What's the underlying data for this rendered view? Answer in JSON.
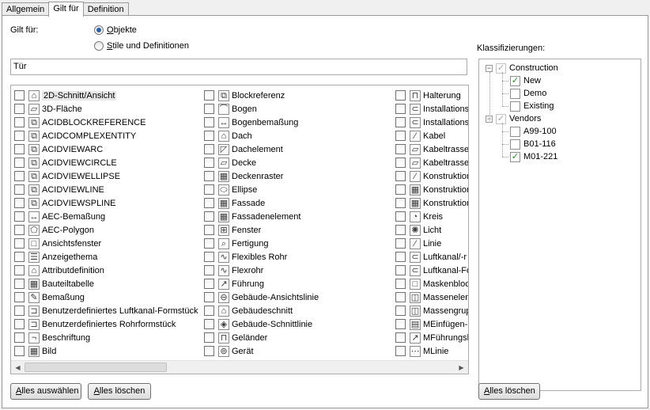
{
  "tabs": [
    "Allgemein",
    "Gilt für",
    "Definition"
  ],
  "gilt_fuer_label": "Gilt für:",
  "radios": [
    {
      "prefix": "",
      "underline": "O",
      "rest": "bjekte",
      "checked": true
    },
    {
      "prefix": "",
      "underline": "S",
      "rest": "tile und Definitionen",
      "checked": false
    }
  ],
  "filter_value": "Tür",
  "columns": [
    [
      {
        "label": "2D-Schnitt/Ansicht",
        "icon": "⌂",
        "selected": true
      },
      {
        "label": "3D-Fläche",
        "icon": "▱"
      },
      {
        "label": "ACIDBLOCKREFERENCE",
        "icon": "⧉"
      },
      {
        "label": "ACIDCOMPLEXENTITY",
        "icon": "⧉"
      },
      {
        "label": "ACIDVIEWARC",
        "icon": "⧉"
      },
      {
        "label": "ACIDVIEWCIRCLE",
        "icon": "⧉"
      },
      {
        "label": "ACIDVIEWELLIPSE",
        "icon": "⧉"
      },
      {
        "label": "ACIDVIEWLINE",
        "icon": "⧉"
      },
      {
        "label": "ACIDVIEWSPLINE",
        "icon": "⧉"
      },
      {
        "label": "AEC-Bemaßung",
        "icon": "↔"
      },
      {
        "label": "AEC-Polygon",
        "icon": "⬠"
      },
      {
        "label": "Ansichtsfenster",
        "icon": "□"
      },
      {
        "label": "Anzeigethema",
        "icon": "☰"
      },
      {
        "label": "Attributdefinition",
        "icon": "⌂"
      },
      {
        "label": "Bauteiltabelle",
        "icon": "▦"
      },
      {
        "label": "Bemaßung",
        "icon": "✎"
      },
      {
        "label": "Benutzerdefiniertes Luftkanal-Formstück",
        "icon": "⊐"
      },
      {
        "label": "Benutzerdefiniertes Rohrformstück",
        "icon": "⊐"
      },
      {
        "label": "Beschriftung",
        "icon": "¬"
      },
      {
        "label": "Bild",
        "icon": "▦"
      }
    ],
    [
      {
        "label": "Blockreferenz",
        "icon": "⧉"
      },
      {
        "label": "Bogen",
        "icon": "⌒"
      },
      {
        "label": "Bogenbemaßung",
        "icon": "↔"
      },
      {
        "label": "Dach",
        "icon": "⌂"
      },
      {
        "label": "Dachelement",
        "icon": "◸"
      },
      {
        "label": "Decke",
        "icon": "▱"
      },
      {
        "label": "Deckenraster",
        "icon": "▦"
      },
      {
        "label": "Ellipse",
        "icon": "⬭"
      },
      {
        "label": "Fassade",
        "icon": "▦"
      },
      {
        "label": "Fassadenelement",
        "icon": "▦"
      },
      {
        "label": "Fenster",
        "icon": "⊞"
      },
      {
        "label": "Fertigung",
        "icon": "⌕"
      },
      {
        "label": "Flexibles Rohr",
        "icon": "∿"
      },
      {
        "label": "Flexrohr",
        "icon": "∿"
      },
      {
        "label": "Führung",
        "icon": "↗"
      },
      {
        "label": "Gebäude-Ansichtslinie",
        "icon": "⊖"
      },
      {
        "label": "Gebäudeschnitt",
        "icon": "⌂"
      },
      {
        "label": "Gebäude-Schnittlinie",
        "icon": "◈"
      },
      {
        "label": "Geländer",
        "icon": "⊓"
      },
      {
        "label": "Gerät",
        "icon": "⊚"
      }
    ],
    [
      {
        "label": "Halterung",
        "icon": "⊓"
      },
      {
        "label": "Installations",
        "icon": "⊂"
      },
      {
        "label": "Installations",
        "icon": "⊂"
      },
      {
        "label": "Kabel",
        "icon": "⁄"
      },
      {
        "label": "Kabeltrasse",
        "icon": "▱"
      },
      {
        "label": "Kabeltrasse",
        "icon": "▱"
      },
      {
        "label": "Konstruktion",
        "icon": "⁄"
      },
      {
        "label": "Konstruktion",
        "icon": "▦"
      },
      {
        "label": "Konstruktion",
        "icon": "▦"
      },
      {
        "label": "Kreis",
        "icon": "◔"
      },
      {
        "label": "Licht",
        "icon": "✺"
      },
      {
        "label": "Linie",
        "icon": "⁄"
      },
      {
        "label": "Luftkanal/-r",
        "icon": "⊂"
      },
      {
        "label": "Luftkanal-Fo",
        "icon": "⊂"
      },
      {
        "label": "Maskenblock",
        "icon": "□"
      },
      {
        "label": "Masseneleme",
        "icon": "◫"
      },
      {
        "label": "Massengrup",
        "icon": "◫"
      },
      {
        "label": "MEinfügen-E",
        "icon": "▤"
      },
      {
        "label": "MFührungsli",
        "icon": "↗"
      },
      {
        "label": "MLinie",
        "icon": "⋯"
      }
    ]
  ],
  "buttons": {
    "select_all": {
      "underline": "A",
      "rest": "lles auswählen"
    },
    "clear_all": {
      "underline": "A",
      "rest": "lles löschen"
    },
    "clear_all_right": {
      "underline": "A",
      "rest": "lles löschen"
    }
  },
  "classification_label": "Klassifizierungen:",
  "tree": {
    "groups": [
      {
        "label": "Construction",
        "children": [
          {
            "label": "New",
            "checked": true
          },
          {
            "label": "Demo",
            "checked": false
          },
          {
            "label": "Existing",
            "checked": false
          }
        ]
      },
      {
        "label": "Vendors",
        "children": [
          {
            "label": "A99-100",
            "checked": false
          },
          {
            "label": "B01-116",
            "checked": false
          },
          {
            "label": "M01-221",
            "checked": true
          }
        ]
      }
    ]
  }
}
